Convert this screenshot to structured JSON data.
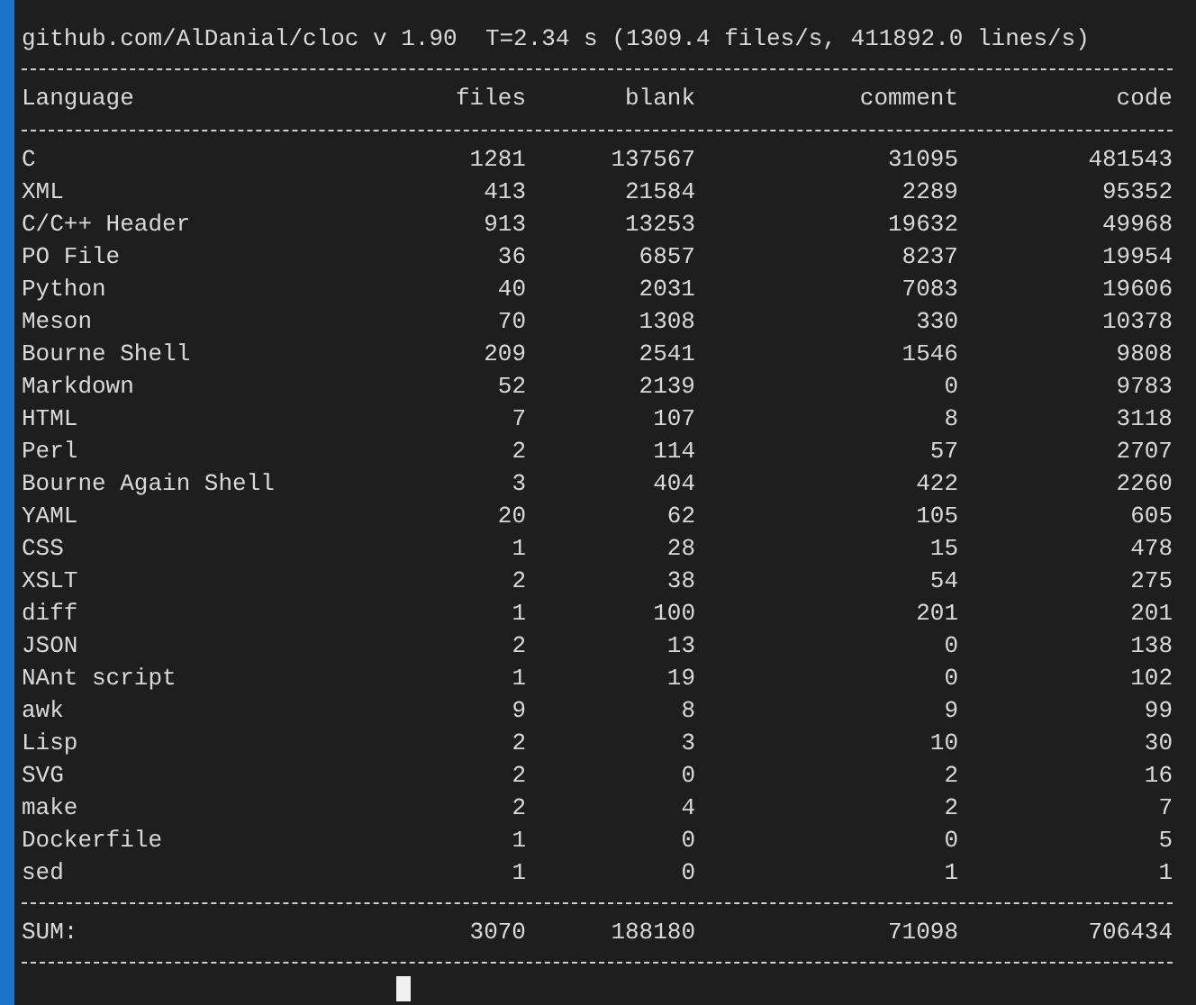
{
  "header_line": "github.com/AlDanial/cloc v 1.90  T=2.34 s (1309.4 files/s, 411892.0 lines/s)",
  "table": {
    "columns": [
      "Language",
      "files",
      "blank",
      "comment",
      "code"
    ],
    "rows": [
      [
        "C",
        "1281",
        "137567",
        "31095",
        "481543"
      ],
      [
        "XML",
        "413",
        "21584",
        "2289",
        "95352"
      ],
      [
        "C/C++ Header",
        "913",
        "13253",
        "19632",
        "49968"
      ],
      [
        "PO File",
        "36",
        "6857",
        "8237",
        "19954"
      ],
      [
        "Python",
        "40",
        "2031",
        "7083",
        "19606"
      ],
      [
        "Meson",
        "70",
        "1308",
        "330",
        "10378"
      ],
      [
        "Bourne Shell",
        "209",
        "2541",
        "1546",
        "9808"
      ],
      [
        "Markdown",
        "52",
        "2139",
        "0",
        "9783"
      ],
      [
        "HTML",
        "7",
        "107",
        "8",
        "3118"
      ],
      [
        "Perl",
        "2",
        "114",
        "57",
        "2707"
      ],
      [
        "Bourne Again Shell",
        "3",
        "404",
        "422",
        "2260"
      ],
      [
        "YAML",
        "20",
        "62",
        "105",
        "605"
      ],
      [
        "CSS",
        "1",
        "28",
        "15",
        "478"
      ],
      [
        "XSLT",
        "2",
        "38",
        "54",
        "275"
      ],
      [
        "diff",
        "1",
        "100",
        "201",
        "201"
      ],
      [
        "JSON",
        "2",
        "13",
        "0",
        "138"
      ],
      [
        "NAnt script",
        "1",
        "19",
        "0",
        "102"
      ],
      [
        "awk",
        "9",
        "8",
        "9",
        "99"
      ],
      [
        "Lisp",
        "2",
        "3",
        "10",
        "30"
      ],
      [
        "SVG",
        "2",
        "0",
        "2",
        "16"
      ],
      [
        "make",
        "2",
        "4",
        "2",
        "7"
      ],
      [
        "Dockerfile",
        "1",
        "0",
        "0",
        "5"
      ],
      [
        "sed",
        "1",
        "0",
        "1",
        "1"
      ]
    ],
    "sum": [
      "SUM:",
      "3070",
      "188180",
      "71098",
      "706434"
    ]
  }
}
